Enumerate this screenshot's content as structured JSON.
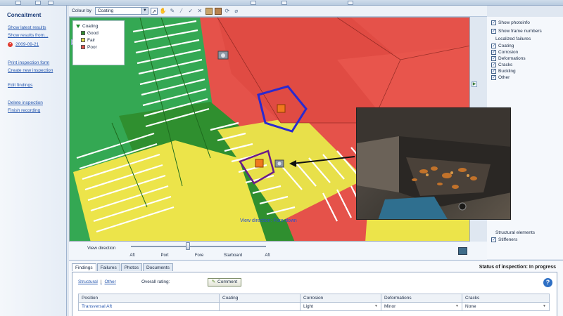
{
  "sidebar": {
    "title": "Concaitment",
    "links": [
      "Show latest results",
      "Show results from..."
    ],
    "date_item": "2009-09-21",
    "actions": [
      "Print inspection form",
      "Create new inspection"
    ],
    "edit_findings": "Edit findings",
    "more_actions": [
      "Delete inspection",
      "Finish recording"
    ]
  },
  "toolbar": {
    "colour_by_label": "Colour by",
    "colour_by_value": "Coating"
  },
  "legend": {
    "title": "Coating",
    "items": [
      {
        "label": "Good",
        "color": "#2f8f2f"
      },
      {
        "label": "Fair",
        "color": "#e8e04a"
      },
      {
        "label": "Poor",
        "color": "#e5524a"
      }
    ]
  },
  "viewport": {
    "overlay_text": "View direction: Fore-down"
  },
  "right_panel": {
    "show_photoinfo": "Show photoinfo",
    "show_frame_numbers": "Show frame numbers",
    "localized_failures_label": "Localized failures",
    "failures": [
      "Coating",
      "Corrosion",
      "Deformations",
      "Cracks",
      "Buckling",
      "Other"
    ],
    "structural_elements_label": "Structural elements",
    "stiffeners": "Stiffeners"
  },
  "view_direction": {
    "label": "View direction",
    "ticks": [
      "Aft",
      "Port",
      "Fore",
      "Starboard",
      "Aft"
    ],
    "slider_position": 0.42
  },
  "bottom": {
    "tabs": [
      "Findings",
      "Failures",
      "Photos",
      "Documents"
    ],
    "active_tab": 0,
    "status": "Status of inspection: In progress",
    "subtabs": [
      "Structural",
      "Other"
    ],
    "overall_rating_label": "Overall rating:",
    "comment_button": "Comment",
    "table": {
      "headers": [
        "Position",
        "Coating",
        "Corrosion",
        "Deformations",
        "Cracks"
      ],
      "rows": [
        [
          "Transversal Aft",
          "",
          "Light",
          "Minor",
          "None"
        ]
      ]
    }
  }
}
